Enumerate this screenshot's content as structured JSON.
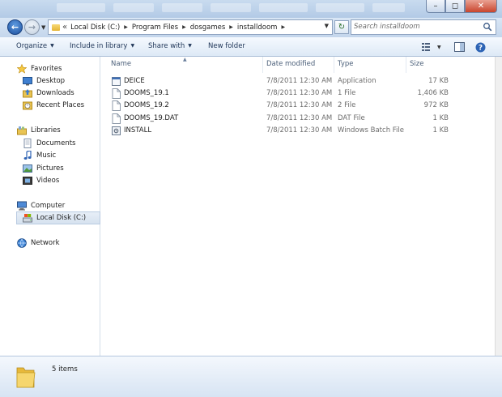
{
  "address": {
    "overflow_chevron": "«",
    "breadcrumbs": [
      "Local Disk (C:)",
      "Program Files",
      "dosgames",
      "installdoom"
    ]
  },
  "search": {
    "placeholder": "Search installdoom"
  },
  "toolbar": {
    "organize": "Organize",
    "include_in_library": "Include in library",
    "share_with": "Share with",
    "new_folder": "New folder"
  },
  "nav": {
    "favorites": "Favorites",
    "desktop": "Desktop",
    "downloads": "Downloads",
    "recent_places": "Recent Places",
    "libraries": "Libraries",
    "documents": "Documents",
    "music": "Music",
    "pictures": "Pictures",
    "videos": "Videos",
    "computer": "Computer",
    "local_disk": "Local Disk (C:)",
    "network": "Network"
  },
  "columns": {
    "name": "Name",
    "date": "Date modified",
    "type": "Type",
    "size": "Size"
  },
  "files": [
    {
      "name": "DEICE",
      "date": "7/8/2011 12:30 AM",
      "type": "Application",
      "size": "17 KB",
      "icon": "application-icon"
    },
    {
      "name": "DOOMS_19.1",
      "date": "7/8/2011 12:30 AM",
      "type": "1 File",
      "size": "1,406 KB",
      "icon": "file-icon"
    },
    {
      "name": "DOOMS_19.2",
      "date": "7/8/2011 12:30 AM",
      "type": "2 File",
      "size": "972 KB",
      "icon": "file-icon"
    },
    {
      "name": "DOOMS_19.DAT",
      "date": "7/8/2011 12:30 AM",
      "type": "DAT File",
      "size": "1 KB",
      "icon": "file-icon"
    },
    {
      "name": "INSTALL",
      "date": "7/8/2011 12:30 AM",
      "type": "Windows Batch File",
      "size": "1 KB",
      "icon": "batch-file-icon"
    }
  ],
  "status": {
    "item_count": "5 items"
  },
  "colors": {
    "accent": "#1c4f9e",
    "chrome": "#c4d6ec",
    "selected": "#d6e2ef"
  }
}
